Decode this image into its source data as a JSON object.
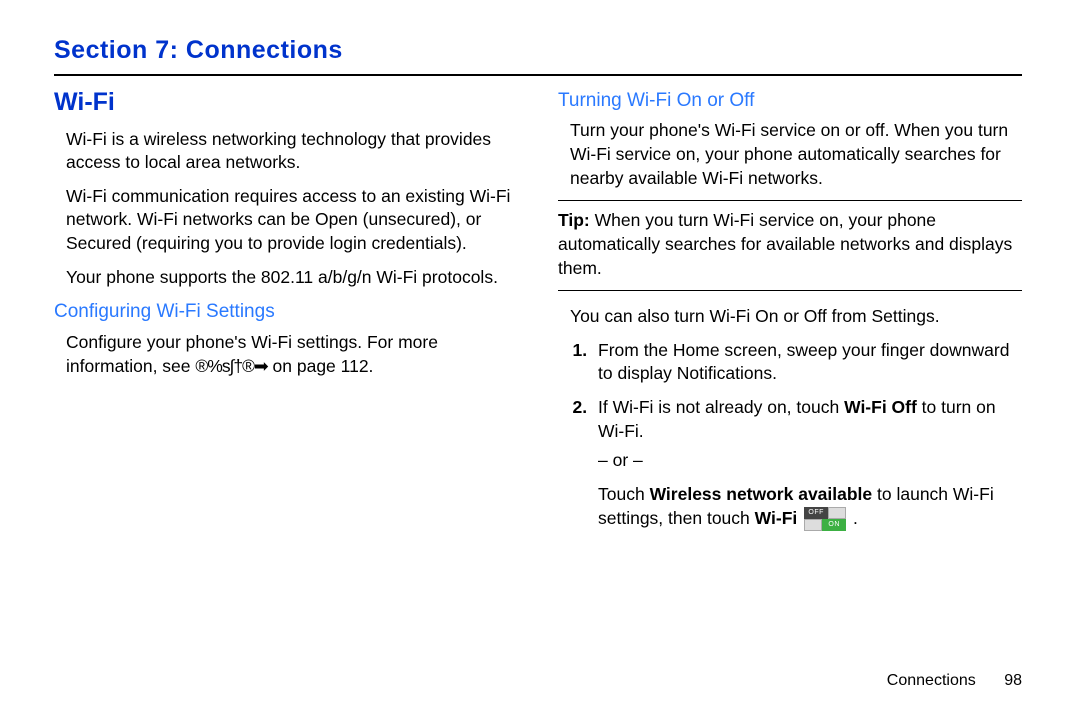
{
  "section_title": "Section 7: Connections",
  "left": {
    "heading": "Wi-Fi",
    "p1": "Wi-Fi is a wireless networking technology that provides access to local area networks.",
    "p2": "Wi-Fi communication requires access to an existing Wi-Fi network. Wi-Fi networks can be Open (unsecured), or Secured (requiring you to provide login credentials).",
    "p3": "Your phone supports the 802.11 a/b/g/n Wi-Fi protocols.",
    "sub": "Configuring Wi-Fi Settings",
    "p4a": "Configure your phone's Wi-Fi settings. For more information, see ",
    "ref_icons": "®%s∫†®➡",
    "p4b": " on page 112."
  },
  "right": {
    "sub": "Turning Wi-Fi On or Off",
    "p1": "Turn your phone's Wi-Fi service on or off. When you turn Wi-Fi service on, your phone automatically searches for nearby available Wi-Fi networks.",
    "tip_label": "Tip:",
    "tip_body": " When you turn Wi-Fi service on, your phone automatically searches for available networks and displays them.",
    "p2": "You can also turn Wi-Fi On or Off from Settings.",
    "step1": "From the Home screen, sweep your finger downward to display Notifications.",
    "step2a": "If Wi-Fi is not already on, touch ",
    "step2_bold": "Wi-Fi Off",
    "step2b": " to turn on Wi-Fi.",
    "or": "– or –",
    "step2c_a": "Touch ",
    "step2c_bold1": "Wireless network available",
    "step2c_b": " to launch Wi-Fi settings, then touch ",
    "step2c_bold2": "Wi-Fi",
    "toggle_off": "OFF",
    "toggle_on": "ON",
    "period": " ."
  },
  "footer": {
    "label": "Connections",
    "page": "98"
  }
}
